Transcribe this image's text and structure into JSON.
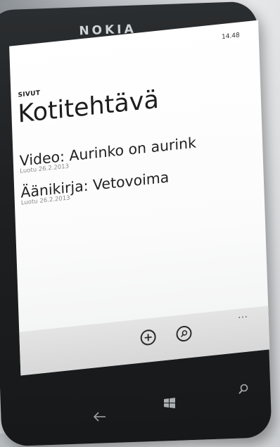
{
  "device": {
    "brand": "NOKIA"
  },
  "status_bar": {
    "time": "14.48"
  },
  "app": {
    "header": "SIVUT",
    "title": "Kotitehtävä"
  },
  "notes": [
    {
      "title": "Video: Aurinko on aurink",
      "created": "Luotu 26.2.2013"
    },
    {
      "title": "Äänikirja: Vetovoima",
      "created": "Luotu 26.2.2013"
    }
  ],
  "app_bar": {
    "more": "...",
    "buttons": [
      {
        "icon": "add-icon"
      },
      {
        "icon": "search-icon"
      }
    ]
  },
  "hardware_buttons": [
    {
      "icon": "back-arrow-icon"
    },
    {
      "icon": "windows-start-icon"
    },
    {
      "icon": "search-icon"
    }
  ],
  "colors": {
    "screen_background": "#ffffff",
    "text": "#1d1d1d",
    "subtext": "#8a8a8a",
    "app_bar": "#dcdcdc",
    "phone_body": "#1e2022"
  }
}
